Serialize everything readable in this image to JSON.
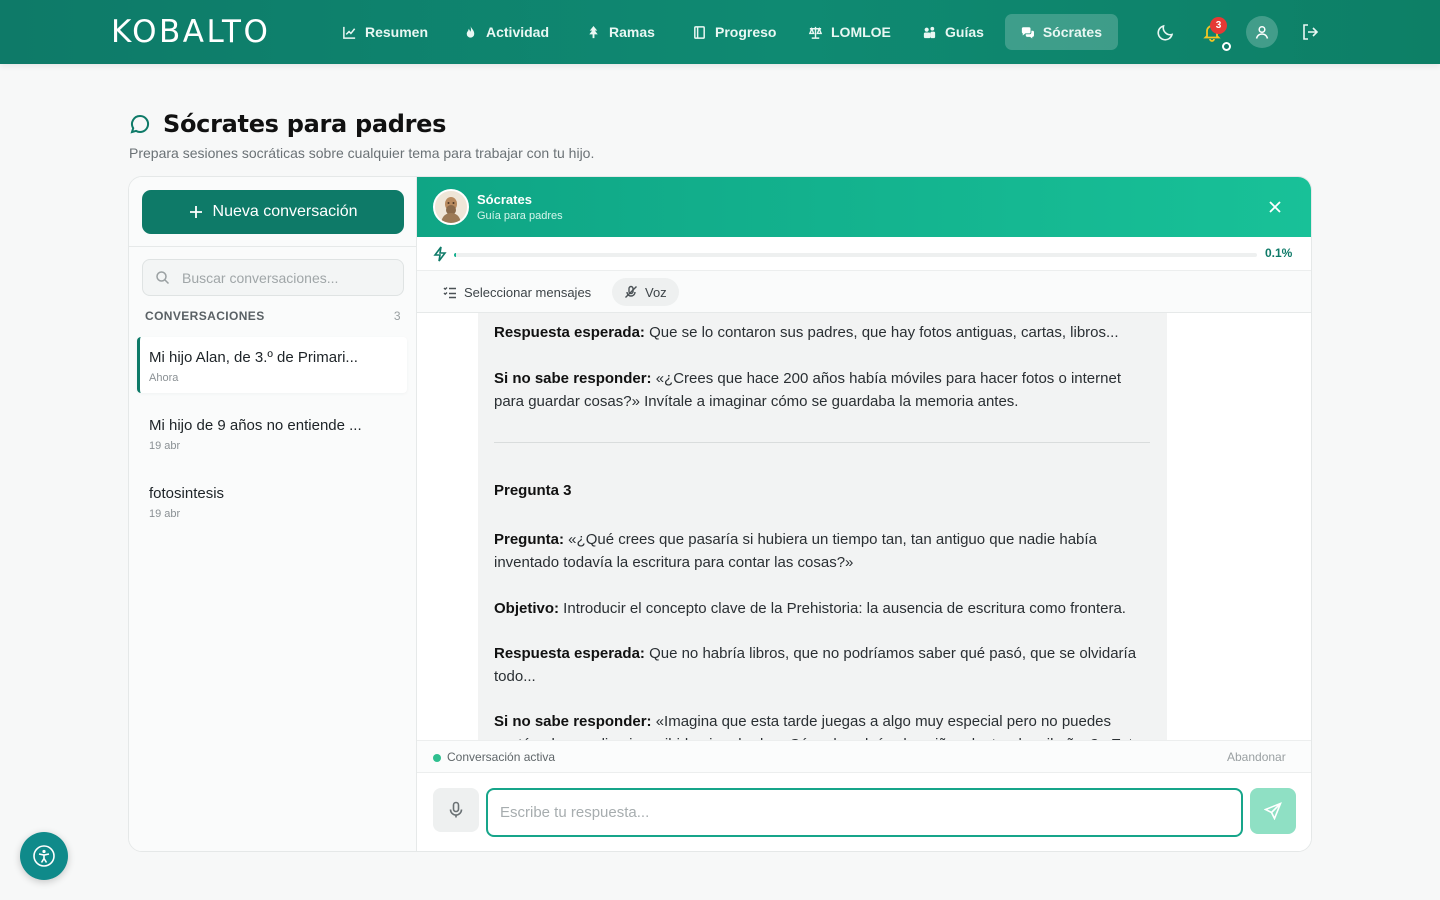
{
  "app": {
    "logo": "KOBALTO"
  },
  "nav": {
    "items": [
      {
        "label": "Resumen",
        "icon": "chart-line-icon"
      },
      {
        "label": "Actividad",
        "icon": "flame-icon"
      },
      {
        "label": "Ramas",
        "icon": "tree-icon"
      },
      {
        "label": "Progreso",
        "icon": "book-icon"
      },
      {
        "label": "LOMLOE",
        "icon": "scale-icon"
      },
      {
        "label": "Guías",
        "icon": "people-icon"
      },
      {
        "label": "Sócrates",
        "icon": "chat-bubbles-icon",
        "active": true
      }
    ],
    "notifications_count": "3"
  },
  "page": {
    "title": "Sócrates para padres",
    "subtitle": "Prepara sesiones socráticas sobre cualquier tema para trabajar con tu hijo."
  },
  "sidebar": {
    "new_conversation": "Nueva conversación",
    "search_placeholder": "Buscar conversaciones...",
    "section_label": "CONVERSACIONES",
    "section_count": "3",
    "conversations": [
      {
        "title": "Mi hijo Alan, de 3.º de Primari...",
        "date": "Ahora",
        "active": true
      },
      {
        "title": "Mi hijo de 9 años no entiende ...",
        "date": "19 abr"
      },
      {
        "title": "fotosintesis",
        "date": "19 abr"
      }
    ]
  },
  "chat": {
    "name": "Sócrates",
    "role": "Guía para padres",
    "progress": 0.1,
    "progress_label": "0.1%",
    "tools": {
      "select": "Seleccionar mensajes",
      "voice": "Voz"
    },
    "message": {
      "p1_label": "Respuesta esperada:",
      "p1_text": " Que se lo contaron sus padres, que hay fotos antiguas, cartas, libros...",
      "p2_label": "Si no sabe responder:",
      "p2_text": " «¿Crees que hace 200 años había móviles para hacer fotos o internet para guardar cosas?» Invítale a imaginar cómo se guardaba la memoria antes.",
      "q3_heading": "Pregunta 3",
      "q3_label": "Pregunta:",
      "q3_text": " «¿Qué crees que pasaría si hubiera un tiempo tan, tan antiguo que nadie había inventado todavía la escritura para contar las cosas?»",
      "obj_label": "Objetivo:",
      "obj_text": " Introducir el concepto clave de la Prehistoria: la ausencia de escritura como frontera.",
      "resp_label": "Respuesta esperada:",
      "resp_text": " Que no habría libros, que no podríamos saber qué pasó, que se olvidaría todo...",
      "nosabe_label": "Si no sabe responder:",
      "nosabe_text": " «Imagina que esta tarde juegas a algo muy especial pero no puedes contárselo a nadie ni escribirlo ni grabarlo. ¿Cómo lo sabrían los niños dentro de mil años?» Esto"
    },
    "status": "Conversación activa",
    "abandon": "Abandonar",
    "input_placeholder": "Escribe tu respuesta..."
  },
  "colors": {
    "brand": "#0e7a68",
    "accent": "#18c198",
    "badge": "#e53935"
  }
}
